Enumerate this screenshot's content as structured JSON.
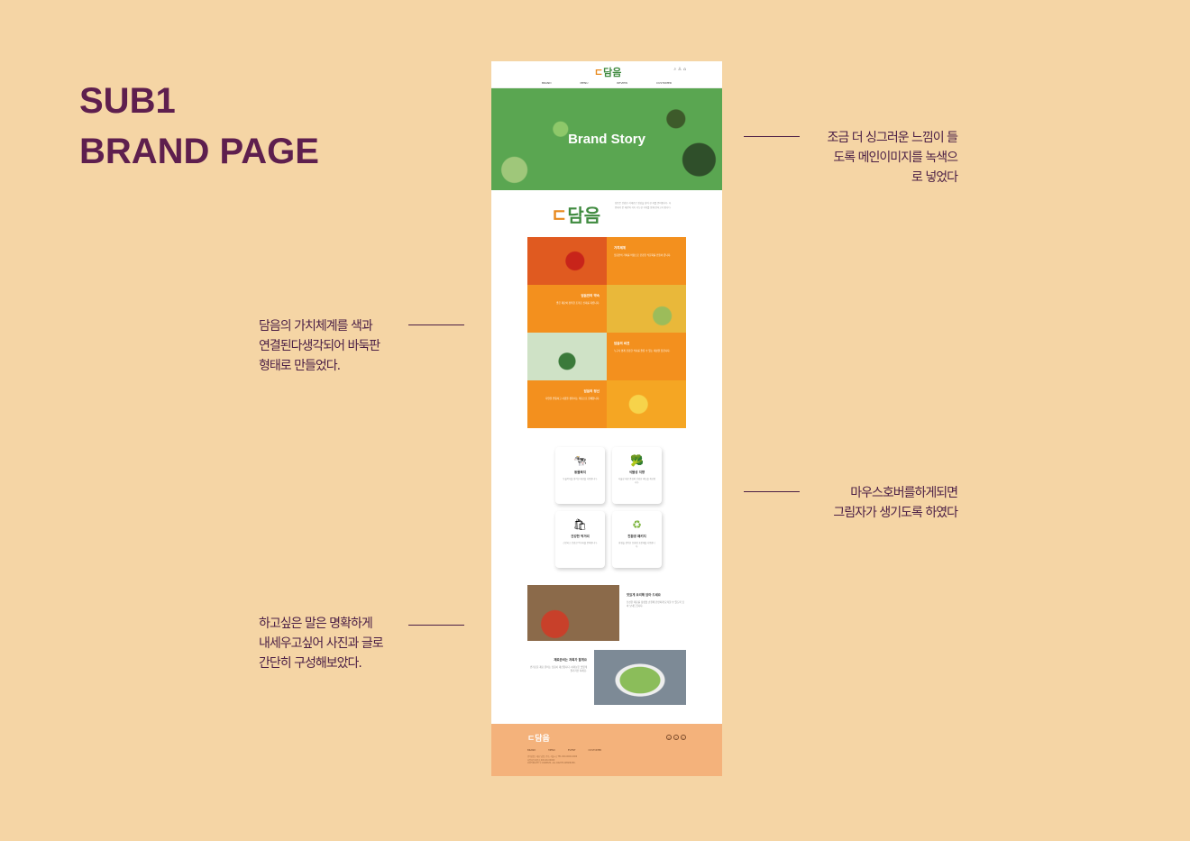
{
  "title": {
    "line1": "SUB1",
    "line2": "BRAND PAGE"
  },
  "notes": {
    "hero": [
      "조금 더 싱그러운 느낌이 들",
      "도록 메인이미지를 녹색으",
      "로 넣었다"
    ],
    "grid": [
      "담음의 가치체계를 색과",
      "연결된다생각되어 바둑판",
      "형태로 만들었다."
    ],
    "cards": [
      "마우스호버를하게되면",
      "그림자가 생기도록 하였다"
    ],
    "sections": [
      "하고싶은 말은 명확하게",
      "내세우고싶어 사진과 글로",
      "간단히 구성해보았다."
    ]
  },
  "site": {
    "logo": "담음",
    "logo_mark": "ㄷ",
    "header_icons": "⌕ ♙ ⌂",
    "nav": [
      "BRAND",
      "MENU",
      "REVIEW",
      "CUSTOMER"
    ],
    "hero_title": "Brand Story",
    "intro": "담음은 건강한 식재료로 정성을 담아 한 끼를 준비합니다. 자연에서 온 재료와 지속 가능한 가치를 함께 전하고자 합니다.",
    "grid": [
      {
        "title": "가치체계",
        "text": "담음만의 가치를 바탕으로 건강한 식문화를 만들어 갑니다."
      },
      {
        "title": "담음만의 약속",
        "text": "좋은 재료와 정직한 조리로 신뢰를 지킵니다."
      },
      {
        "title": "담음의 비전",
        "text": "누구나 쉽게 건강한 식사를 즐길 수 있는 세상을 꿈꿉니다."
      },
      {
        "title": "담음의 정신",
        "text": "자연을 존중하고 사람을 생각하는 마음으로 함께합니다."
      }
    ],
    "cards": [
      {
        "icon": "🐄",
        "title": "동물복지",
        "text": "동물복지를 생각한 재료를 사용합니다."
      },
      {
        "icon": "🥦",
        "title": "식물성 지향",
        "text": "식물성 재료 중심의 건강한 메뉴를 제공합니다."
      },
      {
        "icon": "🛍",
        "title": "건강한 먹거리",
        "text": "신선하고 건강한 먹거리를 준비합니다."
      },
      {
        "icon": "♻",
        "title": "친환경 패키지",
        "text": "환경을 생각한 친환경 포장재를 사용합니다."
      }
    ],
    "section1": {
      "title": "맛있게 요리해 담아 드세요",
      "text": "신선한 재료를 정성껏 손질해 간편하게 요리할 수 있도록 담아 보내드립니다."
    },
    "section2": {
      "title": "재료준비는 저희가 할게요",
      "text": "번거로운 재료 준비는 담음이 대신합니다. 여러분은 맛있게 즐기기만 하세요."
    },
    "footer": {
      "logo": "담음",
      "nav": [
        "BRAND",
        "MENU",
        "EVENT",
        "CUSTOMER"
      ],
      "info": [
        "(주)담음 | 대표 담음 | 주소 서울시 | TEL 000-0000-0000",
        "사업자등록번호 000-00-00000",
        "COPYRIGHT © DAMEUM. ALL RIGHTS RESERVED."
      ],
      "social": [
        "◎",
        "f",
        "t"
      ]
    }
  },
  "colors": {
    "accent": "#5e1f4e",
    "orange": "#f3901e",
    "green": "#5aa651",
    "footer": "#f4b27b"
  }
}
